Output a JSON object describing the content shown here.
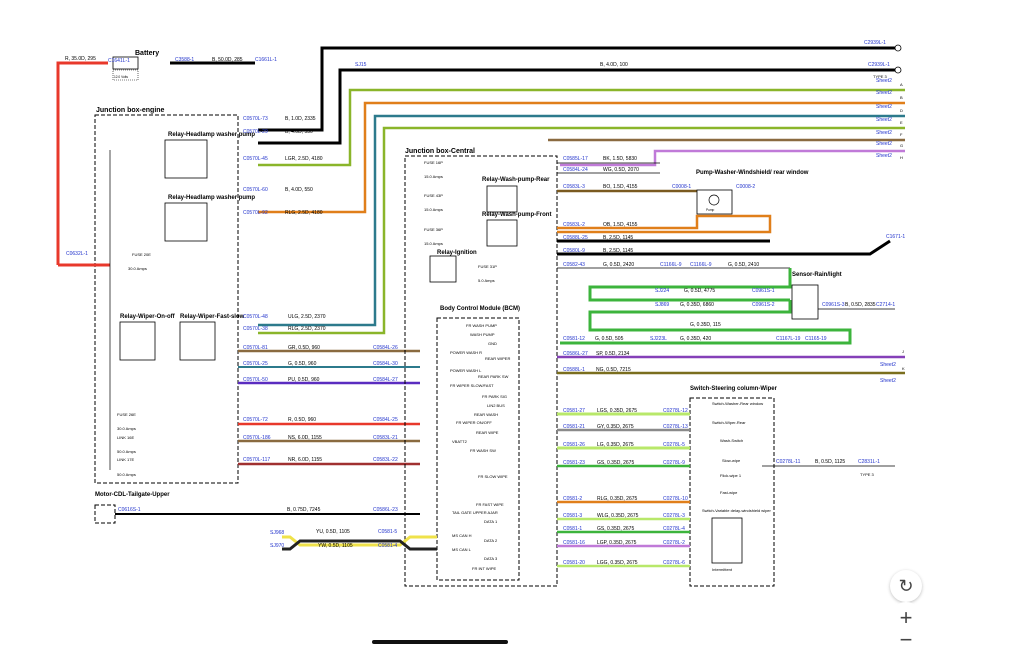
{
  "colors": {
    "red": "#e8382b",
    "black": "#000000",
    "green_yellow": "#8ab52a",
    "orange": "#e07f1a",
    "teal": "#2c7a8c",
    "purple": "#8540b8",
    "brown": "#8a6a40",
    "pink": "#c07ad8",
    "yellow": "#efe24a",
    "bright_green": "#3cb43c",
    "lime": "#b8e86a",
    "olive": "#7a6e1e"
  },
  "battery": {
    "title": "Battery",
    "volts": "12.0 Volts",
    "wire_left": "R, 35.0D, 295",
    "conn_left": "C1641L-1",
    "conn_right": "C3588-1",
    "wire_right": "B, 50.0D, 285",
    "conn_end": "C1661L-1"
  },
  "top_bus": {
    "conn": "C2939L-1",
    "wire": "B, 4.0D, 100",
    "splice": "SJ15",
    "conn2": "C2939L-1",
    "type": "TYPE 3"
  },
  "sheets": [
    {
      "label": "Sheet2",
      "letter": "A"
    },
    {
      "label": "Sheet2",
      "letter": "B"
    },
    {
      "label": "Sheet2",
      "letter": "D"
    },
    {
      "label": "Sheet2",
      "letter": "E"
    },
    {
      "label": "Sheet2",
      "letter": "F"
    },
    {
      "label": "Sheet2",
      "letter": "G"
    },
    {
      "label": "Sheet2",
      "letter": "H"
    }
  ],
  "jb_engine": {
    "title": "Junction box-engine",
    "relay_hl1": "Relay-Headlamp washer pump",
    "relay_hl2": "Relay-Headlamp washer pump",
    "relay_onoff": "Relay-Wiper-On-off",
    "relay_fast": "Relay-Wiper-Fast-slow",
    "fuse20": "FUSE 20E",
    "fuse20_amp": "30.0 Amps",
    "fuse26": "FUSE 26E",
    "fuse26_amp": "30.0 Amps",
    "link16": "LINK 16E",
    "link16_amp": "50.0 Amps",
    "link17": "LINK 17E",
    "link17_amp": "50.0 Amps",
    "conn_left": "C0632L-1"
  },
  "eng_wires": [
    {
      "conn": "C0570L-73",
      "wire": "B, 1.0D, 2335",
      "conn_r": ""
    },
    {
      "conn": "C0570L-29",
      "wire": "B, 4.0D, 530",
      "conn_r": ""
    },
    {
      "conn": "C0570L-45",
      "wire": "LGR, 2.5D, 4180",
      "conn_r": ""
    },
    {
      "conn": "C0570L-60",
      "wire": "B, 4.0D, 550",
      "conn_r": ""
    },
    {
      "conn": "C0570L-92",
      "wire": "RLG, 2.5D, 4180",
      "conn_r": ""
    },
    {
      "conn": "C0570L-48",
      "wire": "ULG, 2.5D, 2370",
      "conn_r": ""
    },
    {
      "conn": "C0570L-38",
      "wire": "RLG, 2.5D, 2370",
      "conn_r": ""
    },
    {
      "conn": "C0570L-81",
      "wire": "GR, 0.5D, 960",
      "conn_r": "C0584L-26"
    },
    {
      "conn": "C0570L-25",
      "wire": "G, 0.5D, 960",
      "conn_r": "C0584L-30"
    },
    {
      "conn": "C0570L-50",
      "wire": "PU, 0.5D, 960",
      "conn_r": "C0584L-27"
    },
    {
      "conn": "C0570L-72",
      "wire": "R, 0.5D, 960",
      "conn_r": "C0584L-25"
    },
    {
      "conn": "C0570L-186",
      "wire": "NS, 6.0D, 1155",
      "conn_r": "C0583L-21"
    },
    {
      "conn": "C0570L-117",
      "wire": "NR, 6.0D, 1155",
      "conn_r": "C0583L-22"
    }
  ],
  "jb_central": {
    "title": "Junction box-Central",
    "fuse16": "FUSE 16P",
    "fuse16_amp": "15.0 Amps",
    "fuse43": "FUSE 43P",
    "fuse43_amp": "15.0 Amps",
    "fuse36": "FUSE 36P",
    "fuse36_amp": "15.0 Amps",
    "fuse31": "FUSE 31P",
    "fuse31_amp": "5.0 Amps",
    "relay_rear": "Relay-Wash-pump-Rear",
    "relay_front": "Relay-Wash-pump-Front",
    "relay_ign": "Relay-Ignition",
    "bcm": "Body Control Module (BCM)"
  },
  "bcm_pins": [
    "FR WASH PUMP",
    "WASH PUMP",
    "GND",
    "POWER WASH R",
    "REAR WIPER",
    "POWER WASH L",
    "REAR PARK SW",
    "FR WIPER SLOW/FAST",
    "FR PARK SIG",
    "LIN2 BUS",
    "REAR WASH",
    "FR WIPER ON/OFF",
    "REAR WIPE",
    "VBATT2",
    "FR WASH SW",
    "FR SLOW WIPE",
    "FR FAST WIPE",
    "TAIL GATE UPPER AJAR",
    "DATA 1",
    "MS CAN H",
    "DATA 2",
    "MS CAN L",
    "DATA 3",
    "FR INT WIPE"
  ],
  "central_wires": [
    {
      "conn": "C0585L-17",
      "wire": "BK, 1.5D, 5830"
    },
    {
      "conn": "C0584L-24",
      "wire": "WG, 0.5D, 2070"
    },
    {
      "conn": "C0583L-3",
      "wire": "BO, 1.5D, 4155",
      "conn_r": "C0008-1"
    },
    {
      "conn": "C0583L-2",
      "wire": "OB, 1.5D, 4155",
      "conn_r": "C0008-2"
    },
    {
      "conn": "C0588L-25",
      "wire": "B, 2.5D, 1145"
    },
    {
      "conn": "C0580L-9",
      "wire": "B, 2.5D, 1145",
      "conn_r": "C1671-1"
    },
    {
      "conn": "C0582-43",
      "wire": "G, 0.5D, 2420",
      "conn_m": "C1166L-9",
      "conn_m2": "C1166L-9",
      "wire2": "G, 0.5D, 2410"
    }
  ],
  "pump": {
    "title": "Pump-Washer-Windshield/ rear window",
    "inner": "Pump"
  },
  "sensor": {
    "title": "Sensor-Rain/light",
    "c1": "C0961S-1",
    "c2": "C0961S-2",
    "c3": "C0961S-3",
    "wire": "B, 0.5D, 2835",
    "conn_r": "C2714-1"
  },
  "green_bus": {
    "sj224": "SJ224",
    "w1": "G, 0.5D, 4775",
    "sj869": "SJ869",
    "w2": "G, 0.35D, 6860",
    "w3": "G, 0.35D, 115",
    "c0581": "C0581-12",
    "w4": "G, 0.5D, 505",
    "sj223": "SJ223L",
    "w5": "G, 0.35D, 420",
    "c1167": "C1167L-19",
    "c1165": "C1165-19"
  },
  "sheet_lower": [
    {
      "conn": "C0586L-27",
      "wire": "SP, 0.5D, 2134",
      "label": "Sheet2",
      "letter": "J"
    },
    {
      "conn": "C0588L-1",
      "wire": "NG, 0.5D, 7215",
      "label": "Sheet2",
      "letter": "K"
    }
  ],
  "switch": {
    "title": "Switch-Steering column-Wiper",
    "s1": "Switch-Washer-Rear window",
    "s2": "Switch-Wiper-Rear",
    "s3": "Wash-Switch",
    "s4": "Slow-wipe",
    "s5": "Flick-wipe 1",
    "s6": "Fast-wipe",
    "s7": "Switch-Variable delay-windshield wiper",
    "s8": "Intermittent",
    "out_conn": "C0278L-11",
    "out_wire": "B, 0.5D, 1125",
    "out_r": "C2831L-1",
    "out_type": "TYPE 3"
  },
  "switch_wires": [
    {
      "c": "C0581-27",
      "w": "LGS, 0.35D, 2675",
      "r": "C0278L-12"
    },
    {
      "c": "C0581-21",
      "w": "GY, 0.35D, 2675",
      "r": "C0278L-13"
    },
    {
      "c": "C0581-26",
      "w": "LG, 0.35D, 2675",
      "r": "C0278L-5"
    },
    {
      "c": "C0581-23",
      "w": "GS, 0.35D, 2675",
      "r": "C0278L-9"
    },
    {
      "c": "C0581-2",
      "w": "RLG, 0.35D, 2675",
      "r": "C0278L-10"
    },
    {
      "c": "C0581-3",
      "w": "WLG, 0.35D, 2675",
      "r": "C0278L-3"
    },
    {
      "c": "C0581-1",
      "w": "GS, 0.35D, 2675",
      "r": "C0278L-4"
    },
    {
      "c": "C0581-16",
      "w": "LGP, 0.35D, 2675",
      "r": "C0278L-2"
    },
    {
      "c": "C0581-20",
      "w": "LGG, 0.35D, 2675",
      "r": "C0278L-6"
    }
  ],
  "tailgate": {
    "title": "Motor-CDL-Tailgate-Upper",
    "conn": "C0616S-1",
    "wire": "B, 0.75D, 7245",
    "conn_r": "C0586L-23"
  },
  "can": {
    "sj1": "SJ968",
    "sj2": "SJ970",
    "w1": "YU, 0.5D, 1105",
    "w2": "YW, 0.5D, 1105",
    "c1": "C0581-5",
    "c2": "C0581-4"
  },
  "controls": {
    "refresh": "↻",
    "zoom_in": "+",
    "zoom_out": "−"
  }
}
